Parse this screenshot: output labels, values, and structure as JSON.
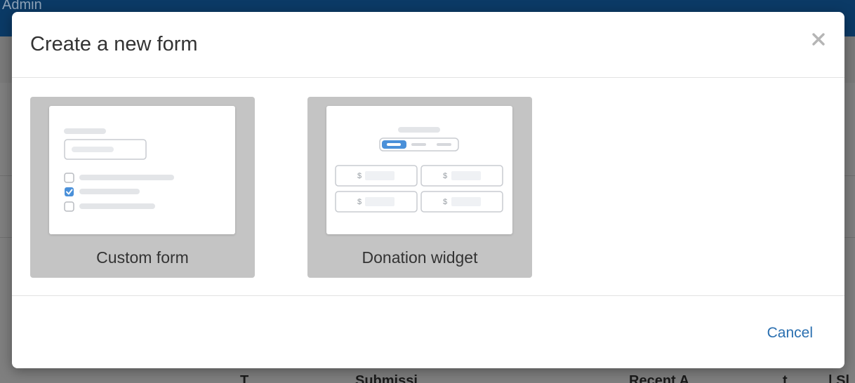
{
  "background": {
    "header_label": "Admin",
    "footer_fragments": [
      "T",
      "Submissi",
      "Recent A",
      "t",
      "| Sl"
    ]
  },
  "modal": {
    "title": "Create a new form",
    "close_icon": "close-icon",
    "options": [
      {
        "label": "Custom form",
        "preview_icon": "custom-form-preview"
      },
      {
        "label": "Donation widget",
        "preview_icon": "donation-widget-preview",
        "currency_symbol": "$"
      }
    ],
    "cancel_label": "Cancel"
  },
  "colors": {
    "header_bg": "#0b3a66",
    "card_bg": "#c4c4c4",
    "accent": "#2a6fb0",
    "checkbox_checked": "#4a90d9"
  }
}
